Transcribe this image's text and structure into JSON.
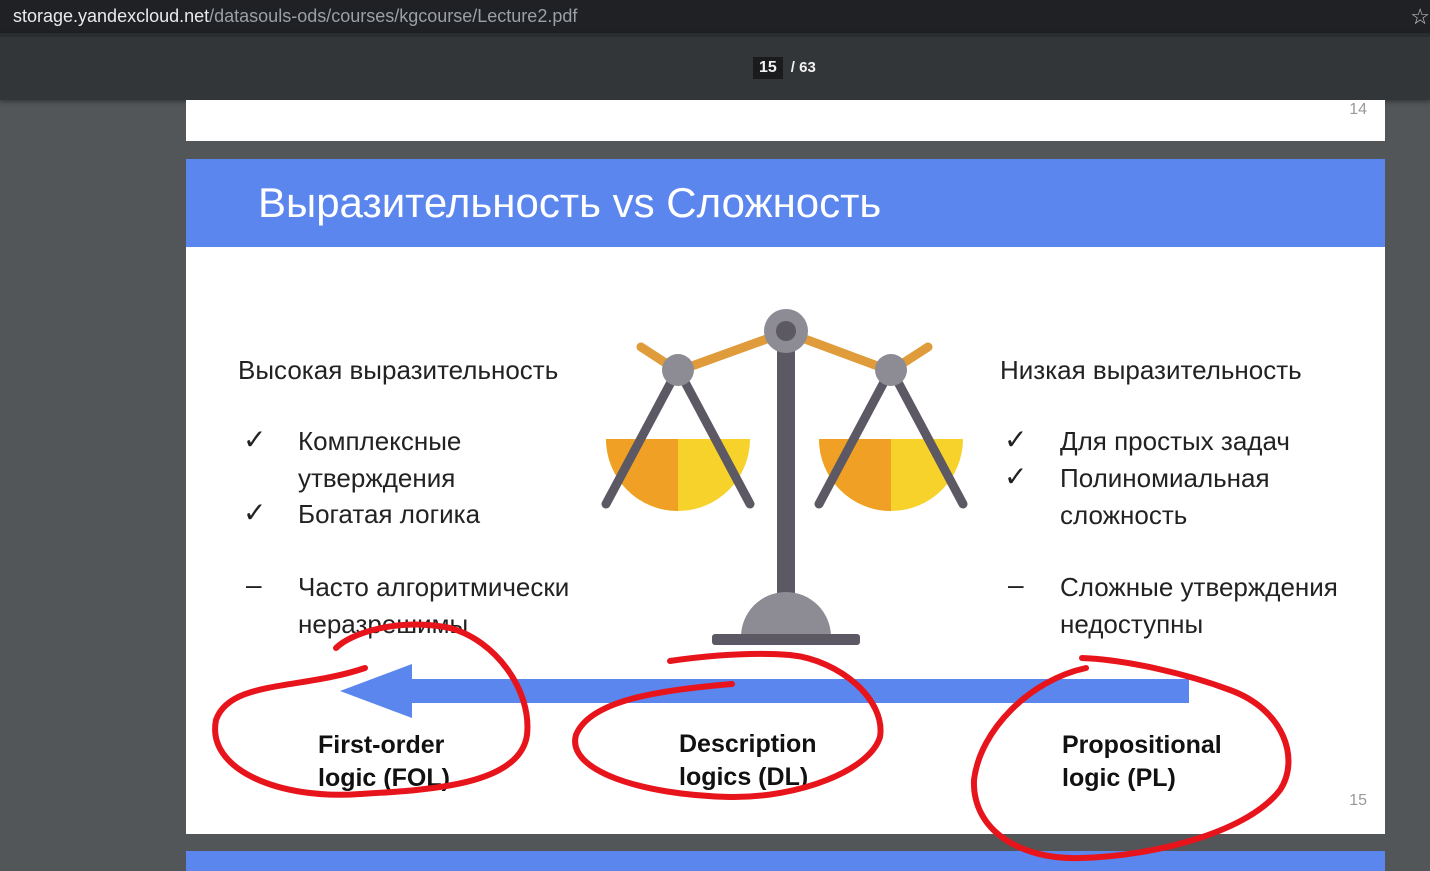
{
  "browser": {
    "url_host": "storage.yandexcloud.net",
    "url_path": "/datasouls-ods/courses/kgcourse/Lecture2.pdf",
    "star_icon": "star-icon"
  },
  "viewer": {
    "current_page": "15",
    "separator": "/",
    "total_pages": "63"
  },
  "previous_page": {
    "number": "14"
  },
  "slide": {
    "title": "Выразительность vs Сложность",
    "page_number": "15",
    "accent_color": "#5b86ee",
    "left": {
      "heading": "Высокая выразительность",
      "items": [
        {
          "mark": "✓",
          "lines": [
            "Комплексные",
            "утверждения"
          ]
        },
        {
          "mark": "✓",
          "lines": [
            "Богатая логика"
          ]
        },
        {
          "mark": "–",
          "lines": [
            "Часто алгоритмически",
            "неразрешимы"
          ]
        }
      ]
    },
    "right": {
      "heading": "Низкая выразительность",
      "items": [
        {
          "mark": "✓",
          "lines": [
            "Для простых задач"
          ]
        },
        {
          "mark": "✓",
          "lines": [
            "Полиномиальная",
            "сложность"
          ]
        },
        {
          "mark": "–",
          "lines": [
            "Сложные утверждения",
            "недоступны"
          ]
        }
      ]
    },
    "logics": [
      {
        "line1": "First-order",
        "line2": "logic (FOL)"
      },
      {
        "line1": "Description",
        "line2": "logics (DL)"
      },
      {
        "line1": "Propositional",
        "line2": "logic (PL)"
      }
    ],
    "illustration": "balance-scale-icon",
    "annotation_color": "#e8141b"
  }
}
